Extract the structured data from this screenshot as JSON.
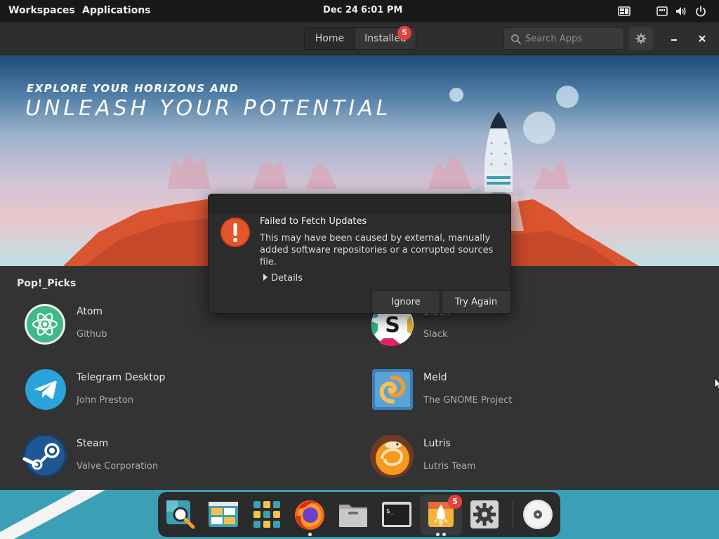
{
  "top_panel": {
    "workspaces": "Workspaces",
    "applications": "Applications",
    "date": "Dec 24",
    "time": "6:01 PM",
    "icons": [
      "window-tiling-icon",
      "network-icon",
      "volume-icon",
      "power-icon"
    ]
  },
  "header": {
    "tabs": [
      {
        "label": "Home",
        "active": false
      },
      {
        "label": "Installed",
        "active": true
      }
    ],
    "installed_badge": "5",
    "search_placeholder": "Search Apps",
    "icons": [
      "search-icon",
      "gear-icon",
      "minimize-icon",
      "close-icon"
    ]
  },
  "banner": {
    "line1": "EXPLORE YOUR HORIZONS AND",
    "line2": "UNLEASH YOUR POTENTIAL"
  },
  "picks": {
    "title": "Pop!_Picks",
    "apps": [
      {
        "name": "Atom",
        "developer": "Github",
        "icon": "atom-icon"
      },
      {
        "name": "Slack",
        "developer": "Slack",
        "icon": "slack-icon"
      },
      {
        "name": "Telegram Desktop",
        "developer": "John Preston",
        "icon": "telegram-icon"
      },
      {
        "name": "Meld",
        "developer": "The GNOME Project",
        "icon": "meld-icon"
      },
      {
        "name": "Steam",
        "developer": "Valve Corporation",
        "icon": "steam-icon"
      },
      {
        "name": "Lutris",
        "developer": "Lutris Team",
        "icon": "lutris-icon"
      }
    ]
  },
  "dialog": {
    "title": "Failed to Fetch Updates",
    "message": "This may have been caused by external, manually added software repositories or a corrupted sources file.",
    "details_label": "Details",
    "ignore_label": "Ignore",
    "retry_label": "Try Again",
    "icon": "error-icon"
  },
  "dock": {
    "items": [
      "search-app-icon",
      "files-layout-icon",
      "app-grid-icon",
      "firefox-icon",
      "file-manager-icon",
      "terminal-icon",
      "pop-shop-icon",
      "settings-app-icon",
      "optical-disc-icon"
    ],
    "shop_badge": "5"
  },
  "colors": {
    "badge_red": "#e5413a",
    "panel_bg": "#181818",
    "window_bg": "#333333",
    "dialog_bg": "#2c2c2c",
    "error_orange": "#d6401f"
  }
}
